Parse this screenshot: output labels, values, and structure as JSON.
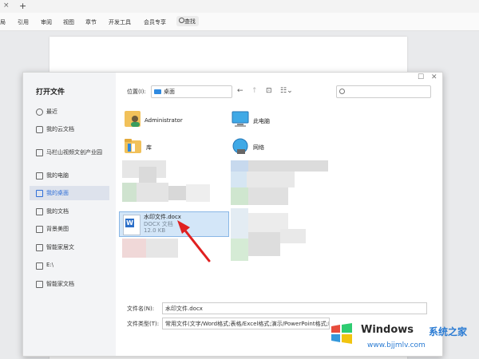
{
  "tabbar": {
    "close": "×",
    "new_tab": "+"
  },
  "ribbon": {
    "items": [
      "局",
      "引用",
      "审阅",
      "视图",
      "章节",
      "开发工具",
      "会员专享"
    ],
    "search_label": "查找"
  },
  "dialog": {
    "title": "打开文件",
    "sidebar": [
      {
        "label": "最近",
        "icon": "clock-icon"
      },
      {
        "label": "我的云文档",
        "icon": "cloud-icon"
      },
      {
        "label": "马栏山视频文创产业园",
        "icon": "building-icon"
      },
      {
        "label": "我的电脑",
        "icon": "computer-icon"
      },
      {
        "label": "我的桌面",
        "icon": "desktop-icon",
        "active": true
      },
      {
        "label": "我的文档",
        "icon": "folder-icon"
      },
      {
        "label": "背景美图",
        "icon": "folder-icon"
      },
      {
        "label": "智能家居文",
        "icon": "folder-icon"
      },
      {
        "label": "E:\\",
        "icon": "folder-icon"
      },
      {
        "label": "智能家文档",
        "icon": "folder-icon"
      }
    ],
    "location_label": "位置(I):",
    "location_value": "桌面",
    "items": [
      {
        "label": "Administrator",
        "icon": "user-folder-icon"
      },
      {
        "label": "此电脑",
        "icon": "computer-icon"
      },
      {
        "label": "库",
        "icon": "library-folder-icon"
      },
      {
        "label": "网络",
        "icon": "network-icon"
      }
    ],
    "selected_file": {
      "name": "水印文件.docx",
      "type": "DOCX 文档",
      "size": "12.0 KB",
      "icon_letter": "W"
    },
    "filename_label": "文件名(N):",
    "filename_value": "水印文件.docx",
    "filetype_label": "文件类型(T):",
    "filetype_value": "常用文件(文字/Word格式;表格/Excel格式;演示/PowerPoint格式;PDF"
  },
  "watermark": {
    "title1": "Windows",
    "title2": "系统之家",
    "url": "www.bjjmlv.com"
  },
  "colors": {
    "accent": "#2f6fd8",
    "selection": "#d3e6f8",
    "arrow": "#e02020"
  }
}
